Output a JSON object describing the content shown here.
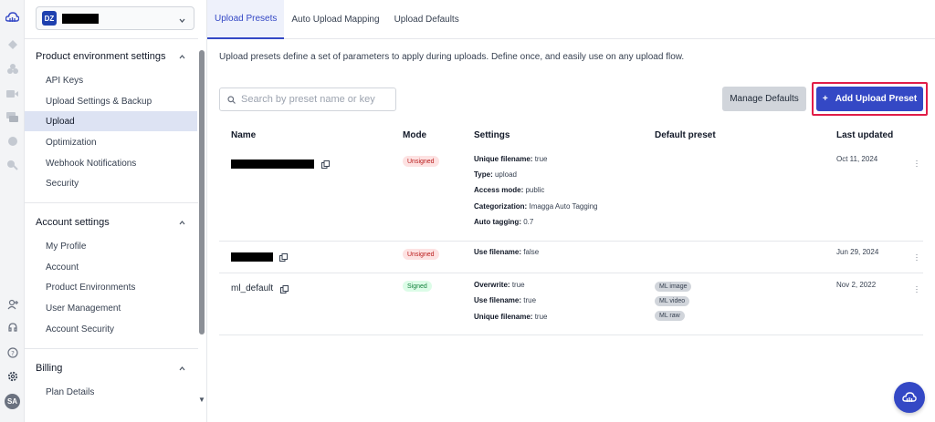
{
  "rail": {
    "icons": [
      "cloud-logo-icon",
      "media-icon",
      "assets-icon",
      "video-icon",
      "chat-icon",
      "globe-icon",
      "integrations-icon"
    ],
    "bottom_icons": [
      "add-user-icon",
      "support-icon",
      "help-icon",
      "settings-icon"
    ],
    "avatar_initials": "SA"
  },
  "sidebar": {
    "env_badge": "DZ",
    "sections": [
      {
        "title": "Product environment settings",
        "items": [
          "API Keys",
          "Upload Settings & Backup",
          "Upload",
          "Optimization",
          "Webhook Notifications",
          "Security"
        ]
      },
      {
        "title": "Account settings",
        "items": [
          "My Profile",
          "Account",
          "Product Environments",
          "User Management",
          "Account Security"
        ]
      },
      {
        "title": "Billing",
        "items": [
          "Plan Details"
        ]
      }
    ],
    "active_item": "Upload"
  },
  "tabs": [
    "Upload Presets",
    "Auto Upload Mapping",
    "Upload Defaults"
  ],
  "active_tab": "Upload Presets",
  "intro": "Upload presets define a set of parameters to apply during uploads. Define once, and easily use on any upload flow.",
  "search": {
    "placeholder": "Search by preset name or key"
  },
  "buttons": {
    "manage_defaults": "Manage Defaults",
    "add_preset": "Add Upload Preset",
    "add_plus": "+"
  },
  "table": {
    "headers": {
      "name": "Name",
      "mode": "Mode",
      "settings": "Settings",
      "default_preset": "Default preset",
      "last_updated": "Last updated"
    },
    "rows": [
      {
        "name": "",
        "mode": "Unsigned",
        "settings": [
          {
            "key": "Unique filename:",
            "value": "true"
          },
          {
            "key": "Type:",
            "value": "upload"
          },
          {
            "key": "Access mode:",
            "value": "public"
          },
          {
            "key": "Categorization:",
            "value": "Imagga Auto Tagging"
          },
          {
            "key": "Auto tagging:",
            "value": "0.7"
          }
        ],
        "defaults": [],
        "updated": "Oct 11, 2024"
      },
      {
        "name": "",
        "mode": "Unsigned",
        "settings": [
          {
            "key": "Use filename:",
            "value": "false"
          }
        ],
        "defaults": [],
        "updated": "Jun 29, 2024"
      },
      {
        "name": "ml_default",
        "mode": "Signed",
        "settings": [
          {
            "key": "Overwrite:",
            "value": "true"
          },
          {
            "key": "Use filename:",
            "value": "true"
          },
          {
            "key": "Unique filename:",
            "value": "true"
          }
        ],
        "defaults": [
          "ML image",
          "ML video",
          "ML raw"
        ],
        "updated": "Nov 2, 2022"
      }
    ]
  },
  "colors": {
    "accent": "#3448c5",
    "highlight": "#e11d48",
    "active_bg": "#dde3f3"
  }
}
